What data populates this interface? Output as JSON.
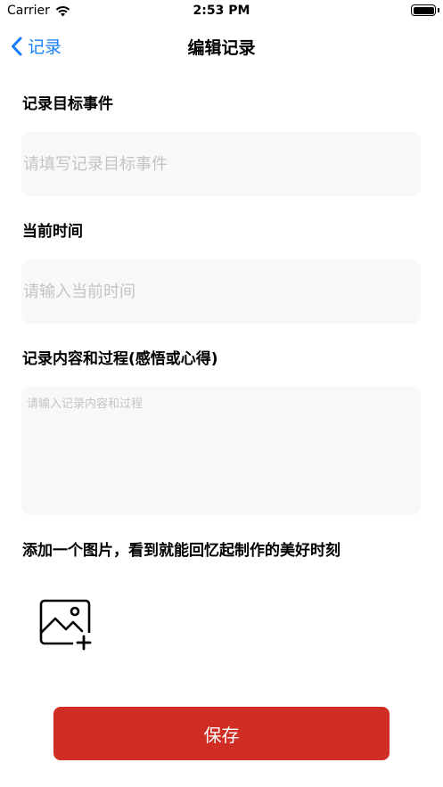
{
  "status_bar": {
    "carrier": "Carrier",
    "time": "2:53 PM"
  },
  "nav": {
    "back_label": "记录",
    "title": "编辑记录"
  },
  "form": {
    "target_label": "记录目标事件",
    "target_placeholder": "请填写记录目标事件",
    "time_label": "当前时间",
    "time_placeholder": "请输入当前时间",
    "content_label": "记录内容和过程(感悟或心得)",
    "content_placeholder": "请输入记录内容和过程",
    "image_label": "添加一个图片，看到就能回忆起制作的美好时刻"
  },
  "save_button": {
    "label": "保存"
  },
  "colors": {
    "accent": "#147EFB",
    "save": "#D02E25",
    "field_bg": "#F8F8F9",
    "placeholder": "#C4C4C7"
  },
  "icons": {
    "back": "chevron-left-icon",
    "wifi": "wifi-icon",
    "battery": "battery-icon",
    "add_image": "add-image-icon"
  }
}
